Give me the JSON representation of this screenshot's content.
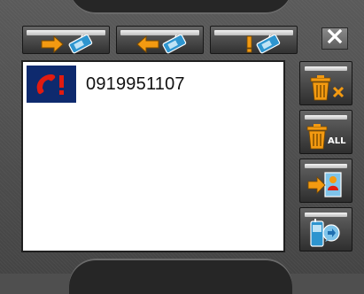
{
  "tabs": [
    {
      "icon": "outgoing-call-icon"
    },
    {
      "icon": "incoming-call-icon"
    },
    {
      "icon": "missed-call-icon"
    }
  ],
  "close_button": {
    "icon": "close-icon"
  },
  "call_list": [
    {
      "type": "missed",
      "icon": "missed-call-phone-icon",
      "number": "0919951107"
    }
  ],
  "side_actions": [
    {
      "icon": "delete-icon"
    },
    {
      "icon": "delete-all-icon",
      "label": "ALL"
    },
    {
      "icon": "save-to-contacts-icon"
    },
    {
      "icon": "dial-icon"
    }
  ],
  "colors": {
    "accent_orange": "#f39a11",
    "phone_blue": "#2e95cf",
    "missed_red": "#e11b10",
    "list_icon_bg": "#0e2a6e"
  }
}
